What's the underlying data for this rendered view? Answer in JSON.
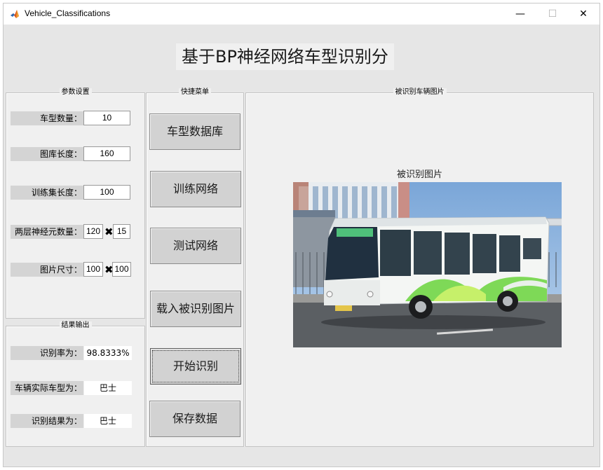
{
  "window": {
    "title": "Vehicle_Classifications",
    "minimize_glyph": "—",
    "maximize_glyph": "☐",
    "close_glyph": "✕",
    "icon": "matlab-logo-icon"
  },
  "main_title": "基于BP神经网络车型识别分",
  "param_panel": {
    "title": "参数设置",
    "fields": [
      {
        "label": "车型数量：",
        "value": "10"
      },
      {
        "label": "图库长度：",
        "value": "160"
      },
      {
        "label": "训练集长度：",
        "value": "100"
      }
    ],
    "neurons": {
      "label": "两层神经元数量：",
      "value1": "120",
      "value2": "15"
    },
    "image_size": {
      "label": "图片尺寸：",
      "value1": "100",
      "value2": "100"
    },
    "times_glyph": "✖"
  },
  "menu_panel": {
    "title": "快捷菜单",
    "buttons": [
      "车型数据库",
      "训练网络",
      "测试网络",
      "载入被识别图片",
      "开始识别",
      "保存数据"
    ]
  },
  "result_panel": {
    "title": "结果输出",
    "rows": [
      {
        "label": "识别率为：",
        "value": "98.8333%"
      },
      {
        "label": "车辆实际车型为：",
        "value": "巴士"
      },
      {
        "label": "识别结果为：",
        "value": "巴士"
      }
    ]
  },
  "image_panel": {
    "title": "被识别车辆图片",
    "plot_title": "被识别图片",
    "photo": "city-bus-photo",
    "colors": {
      "sky": "#8fb4dc",
      "bus_body": "#f4f6f4",
      "bus_green": "#7ed957",
      "road": "#5b5f63"
    }
  }
}
